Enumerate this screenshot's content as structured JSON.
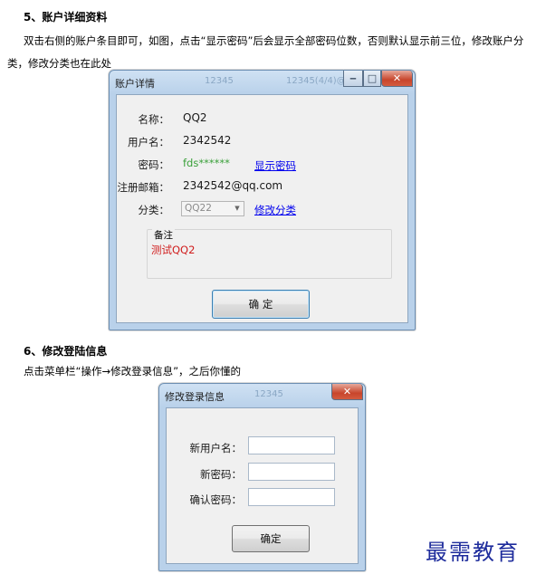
{
  "section5": {
    "heading": "5、账户详细资料",
    "line1": "双击右侧的账户条目即可，如图，点击“显示密码”后会显示全部密码位数，否则默认显示前三位，修改账户分",
    "line2": "类，修改分类也在此处"
  },
  "account_dialog": {
    "title": "账户详情",
    "ghost_title_1": "12345",
    "ghost_title_2": "12345(4/4)@",
    "name_label": "名称：",
    "name_value": "QQ2",
    "username_label": "用户名：",
    "username_value": "2342542",
    "password_label": "密码：",
    "password_value": "fds******",
    "show_password_link": "显示密码",
    "email_label": "注册邮箱：",
    "email_value": "2342542@qq.com",
    "category_label": "分类：",
    "category_selected": "QQ22",
    "edit_category_link": "修改分类",
    "notes_label": "备注",
    "notes_value": "测试QQ2",
    "ok_button": "确 定",
    "colors": {
      "password_value": "#3aa03a",
      "notes_value": "#d01c1c"
    }
  },
  "section6": {
    "heading": "6、修改登陆信息",
    "line1": "点击菜单栏“操作→修改登录信息”，之后你懂的"
  },
  "login_dialog": {
    "title": "修改登录信息",
    "ghost_title": "12345",
    "new_username_label": "新用户名：",
    "new_password_label": "新密码：",
    "confirm_password_label": "确认密码：",
    "ok_button": "确定"
  },
  "watermark": "最需教育"
}
